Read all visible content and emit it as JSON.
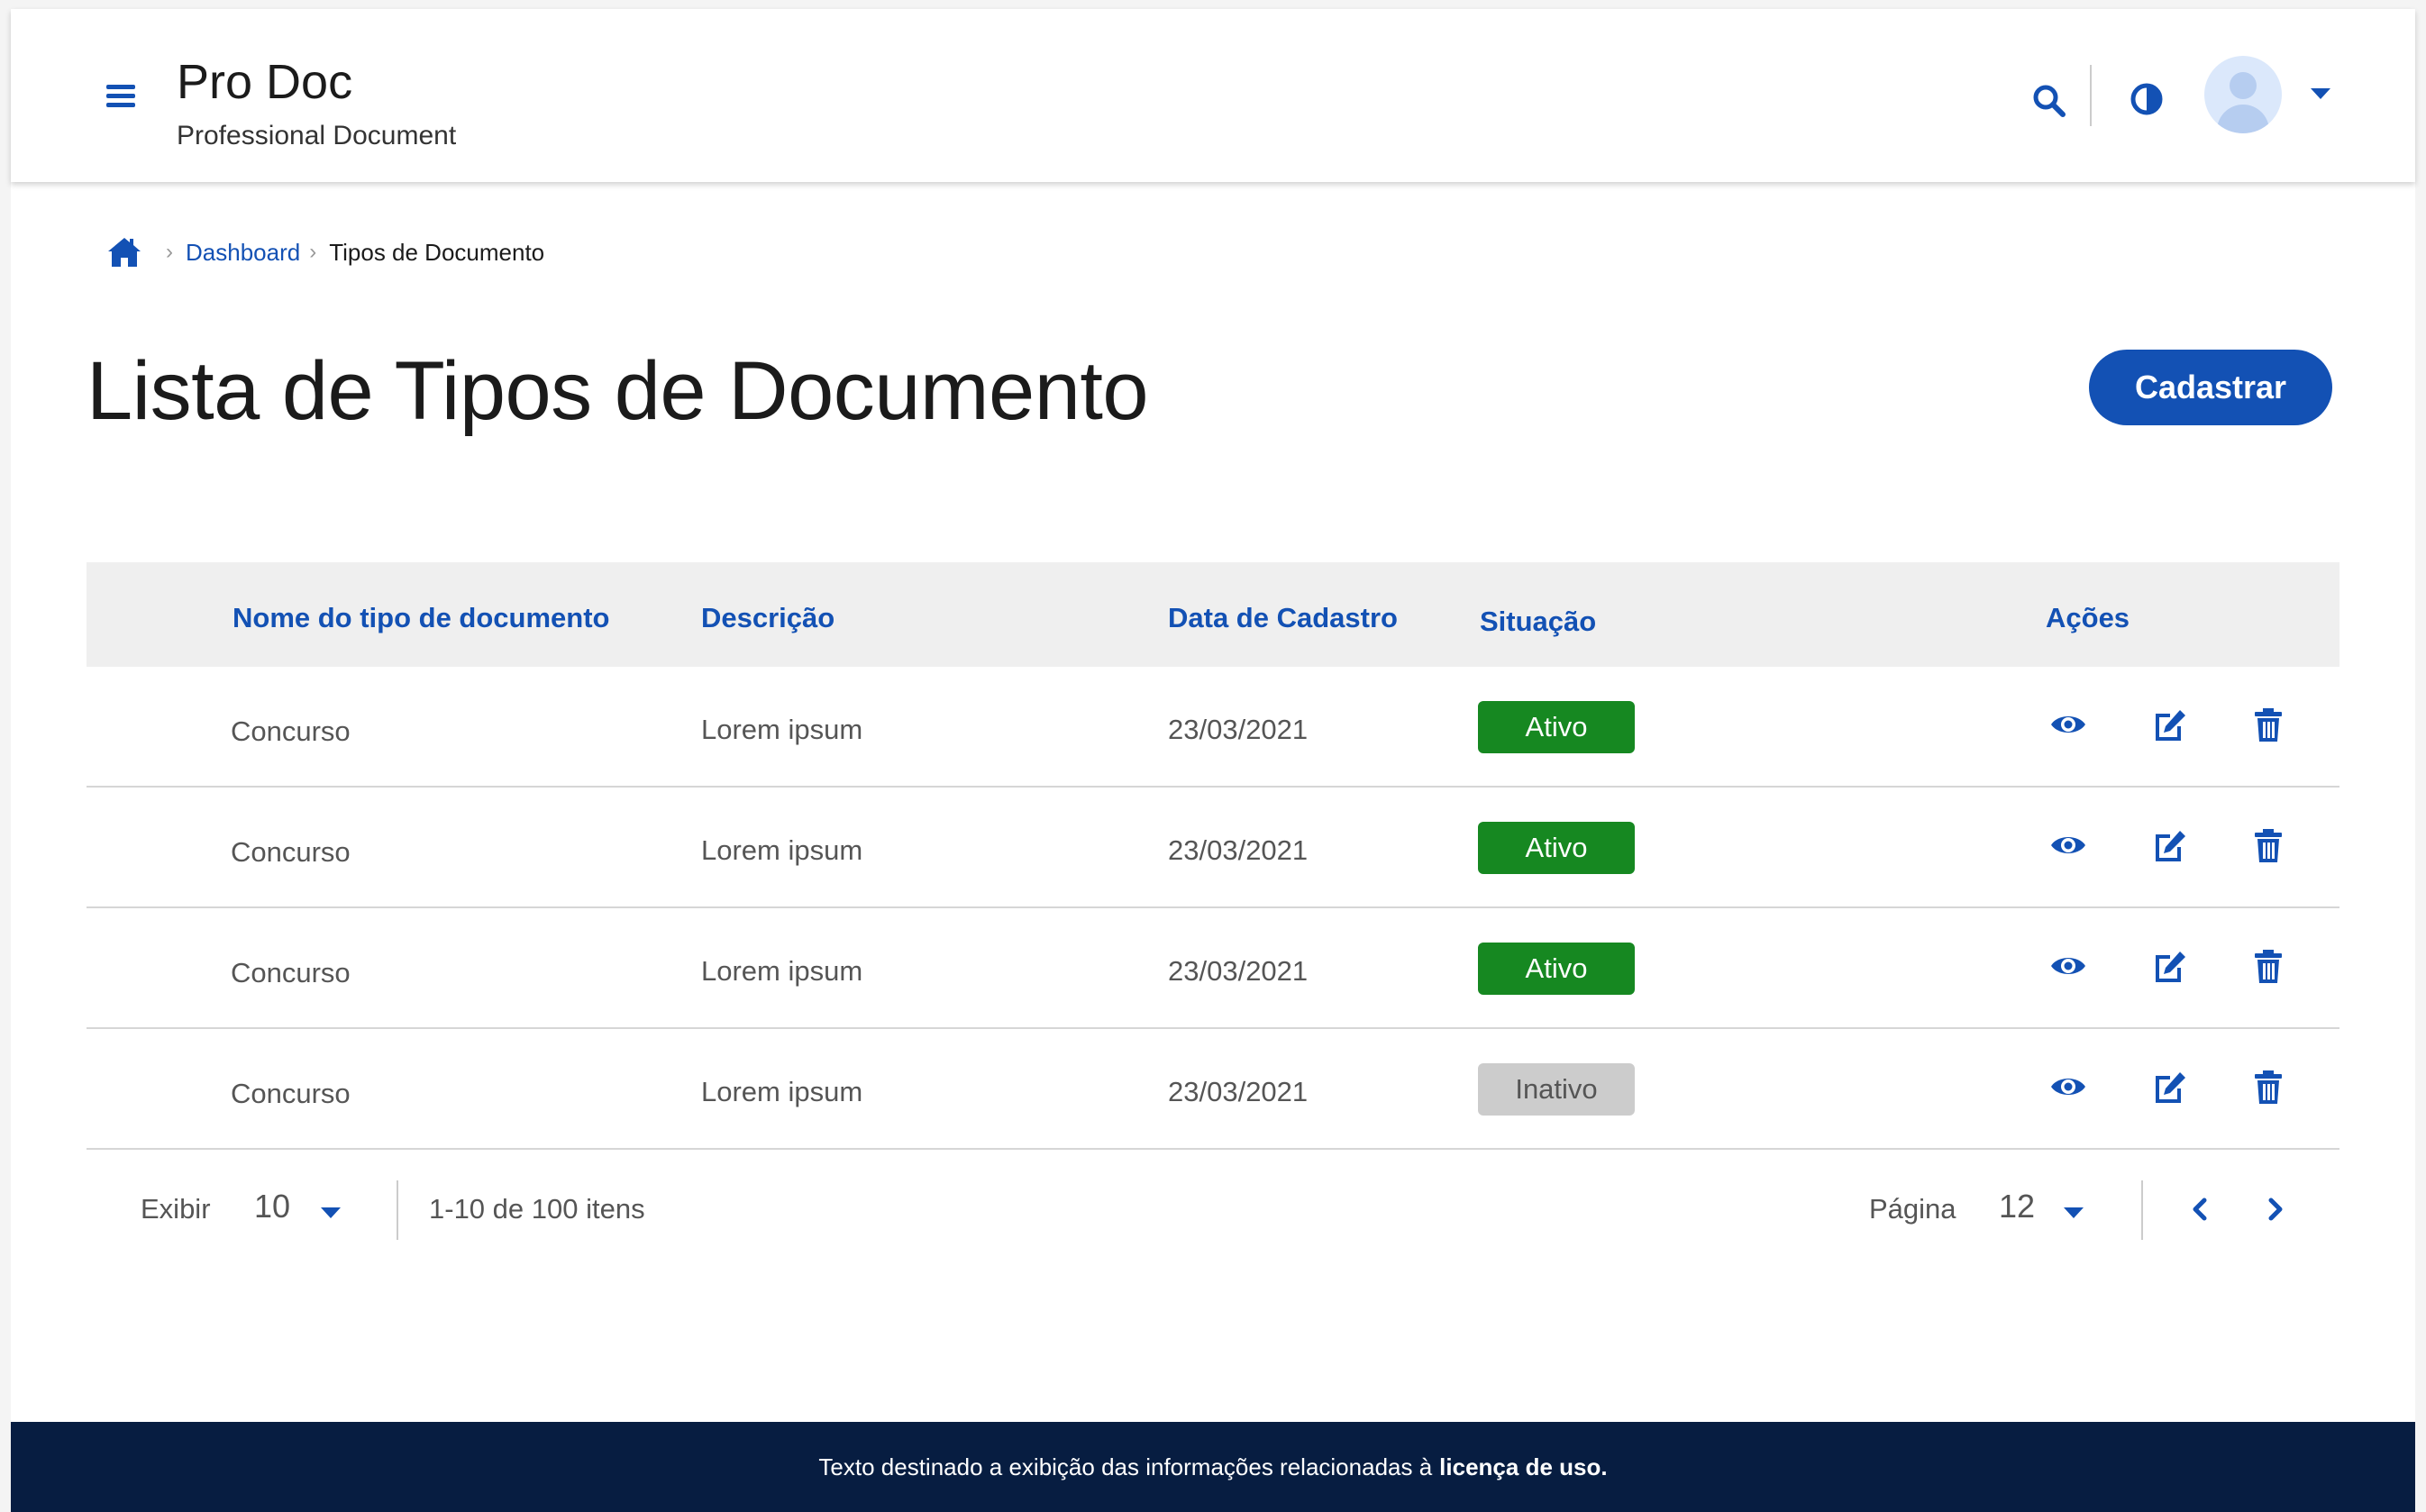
{
  "header": {
    "app_title": "Pro Doc",
    "app_subtitle": "Professional Document",
    "icons": [
      "menu-icon",
      "search-icon",
      "contrast-icon",
      "avatar",
      "chevron-down-icon"
    ]
  },
  "breadcrumb": {
    "home_icon": "home-icon",
    "items": [
      "Dashboard",
      "Tipos de Documento"
    ]
  },
  "page": {
    "title": "Lista de Tipos de Documento",
    "primary_button": "Cadastrar"
  },
  "table": {
    "columns": [
      "Nome do tipo de documento",
      "Descrição",
      "Data de Cadastro",
      "Situação",
      "Ações"
    ],
    "rows": [
      {
        "name": "Concurso",
        "description": "Lorem ipsum",
        "date": "23/03/2021",
        "status": "Ativo",
        "status_kind": "active"
      },
      {
        "name": "Concurso",
        "description": "Lorem ipsum",
        "date": "23/03/2021",
        "status": "Ativo",
        "status_kind": "active"
      },
      {
        "name": "Concurso",
        "description": "Lorem ipsum",
        "date": "23/03/2021",
        "status": "Ativo",
        "status_kind": "active"
      },
      {
        "name": "Concurso",
        "description": "Lorem ipsum",
        "date": "23/03/2021",
        "status": "Inativo",
        "status_kind": "inactive"
      }
    ],
    "row_actions": [
      "eye-icon",
      "edit-icon",
      "trash-icon"
    ]
  },
  "pagination": {
    "show_label": "Exibir",
    "show_value": "10",
    "range_text": "1-10 de 100 itens",
    "page_label": "Página",
    "page_value": "12"
  },
  "footer": {
    "text": "Texto destinado a exibição das informações relacionadas à",
    "bold_text": "licença de uso."
  },
  "colors": {
    "primary": "#1351b4",
    "success": "#168821",
    "inactive": "#cccccc",
    "footer_bg": "#071d41",
    "table_header_bg": "#efefef"
  }
}
